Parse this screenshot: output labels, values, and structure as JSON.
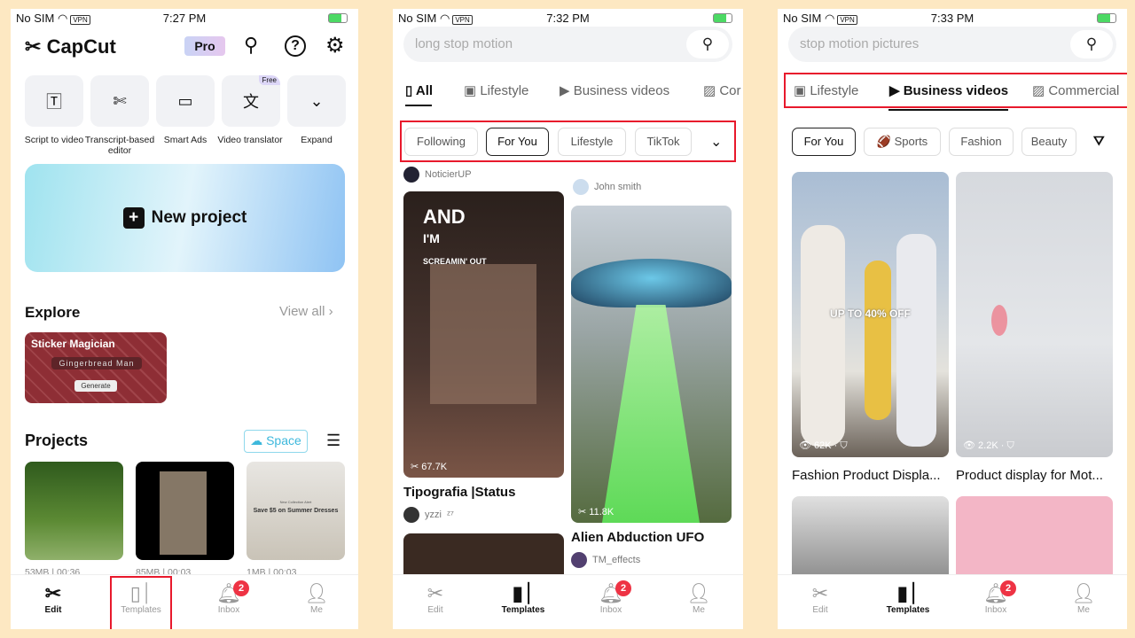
{
  "colors": {
    "background": "#fde8c2",
    "highlight": "#e8192c",
    "badge": "#ee3344",
    "space": "#3db8dc"
  },
  "screens": [
    {
      "status": {
        "carrier": "No SIM",
        "vpn": "VPN",
        "time": "7:27 PM"
      },
      "header": {
        "logo": "CapCut",
        "pro": "Pro",
        "icons": [
          "search-icon",
          "help-icon",
          "gear-icon"
        ]
      },
      "tools": [
        {
          "label": "Script to video",
          "icon": "text-ai-icon"
        },
        {
          "label": "Transcript-based editor",
          "icon": "transcript-scissors-icon"
        },
        {
          "label": "Smart Ads",
          "icon": "ad-sparkle-icon"
        },
        {
          "label": "Video translator",
          "icon": "translate-icon",
          "tag": "Free"
        },
        {
          "label": "Expand",
          "icon": "chevron-down-icon"
        }
      ],
      "new_project": "New project",
      "explore": {
        "title": "Explore",
        "view_all": "View all",
        "card": {
          "title": "Sticker Magician",
          "prompt": "Gingerbread Man",
          "button": "Generate"
        }
      },
      "projects": {
        "title": "Projects",
        "space": "Space",
        "items": [
          {
            "size": "53MB",
            "duration": "00:36"
          },
          {
            "size": "85MB",
            "duration": "00:03"
          },
          {
            "size": "1MB",
            "duration": "00:03",
            "caption": "Save $5 on Summer Dresses",
            "kicker": "New Collection Alert"
          }
        ]
      },
      "nav": [
        {
          "label": "Edit",
          "active": true
        },
        {
          "label": "Templates",
          "highlighted": true
        },
        {
          "label": "Inbox",
          "badge": "2"
        },
        {
          "label": "Me"
        }
      ]
    },
    {
      "status": {
        "carrier": "No SIM",
        "vpn": "VPN",
        "time": "7:32 PM"
      },
      "search": "long stop motion",
      "tabs": [
        {
          "label": "All",
          "active": true
        },
        {
          "label": "Lifestyle"
        },
        {
          "label": "Business videos"
        },
        {
          "label": "Cor"
        }
      ],
      "chips": [
        {
          "label": "Following"
        },
        {
          "label": "For You",
          "active": true
        },
        {
          "label": "Lifestyle"
        },
        {
          "label": "TikTok"
        }
      ],
      "cards": [
        {
          "top_author": "NoticierUP"
        },
        {
          "top_author": "John smith"
        },
        {
          "title": "Tipografia |Status",
          "author": "yzzi",
          "suffix": "ᶻ⁷",
          "uses": "67.7K",
          "overlay": [
            "AND",
            "I'M",
            "SCREAMIN' OUT"
          ]
        },
        {
          "title": "Alien Abduction UFO",
          "author": "TM_effects",
          "uses": "11.8K"
        }
      ],
      "nav": [
        {
          "label": "Edit"
        },
        {
          "label": "Templates",
          "active": true
        },
        {
          "label": "Inbox",
          "badge": "2"
        },
        {
          "label": "Me"
        }
      ]
    },
    {
      "status": {
        "carrier": "No SIM",
        "vpn": "VPN",
        "time": "7:33 PM"
      },
      "search": "stop motion pictures",
      "tabs": [
        {
          "label": "Lifestyle"
        },
        {
          "label": "Business videos",
          "active": true
        },
        {
          "label": "Commercial"
        }
      ],
      "chips": [
        {
          "label": "For You",
          "active": true
        },
        {
          "label": "Sports"
        },
        {
          "label": "Fashion"
        },
        {
          "label": "Beauty"
        }
      ],
      "cards": [
        {
          "title": "Fashion Product Displa...",
          "views": "62K",
          "overlay": "UP TO 40% OFF"
        },
        {
          "title": "Product display for Mot...",
          "views": "2.2K"
        }
      ],
      "nav": [
        {
          "label": "Edit"
        },
        {
          "label": "Templates",
          "active": true
        },
        {
          "label": "Inbox",
          "badge": "2"
        },
        {
          "label": "Me"
        }
      ]
    }
  ]
}
